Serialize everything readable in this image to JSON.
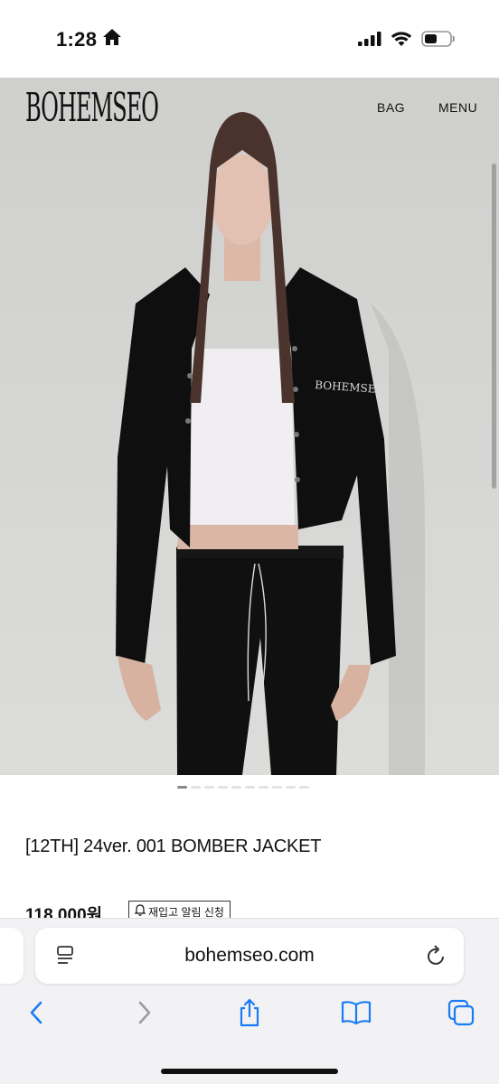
{
  "status_bar": {
    "time": "1:28",
    "icons": [
      "home-icon",
      "signal-icon",
      "wifi-icon",
      "battery-icon"
    ]
  },
  "site": {
    "logo": "BOHEMSEO",
    "nav": {
      "bag": "BAG",
      "menu": "MENU"
    }
  },
  "product": {
    "image_logo": "BOHEMSEO",
    "title": "[12TH] 24ver. 001 BOMBER JACKET",
    "price": "118,000원",
    "restock_label": "재입고 알림 신청",
    "carousel": {
      "total": 10,
      "active_index": 0
    }
  },
  "browser": {
    "url": "bohemseo.com",
    "toolbar": [
      "back-icon",
      "forward-icon",
      "share-icon",
      "bookmarks-icon",
      "tabs-icon"
    ]
  },
  "colors": {
    "background": "#ffffff",
    "jacket": "#111111",
    "wall": "#d8d8d6",
    "link_blue": "#1a7cf5",
    "disabled_gray": "#9b9ba0"
  }
}
